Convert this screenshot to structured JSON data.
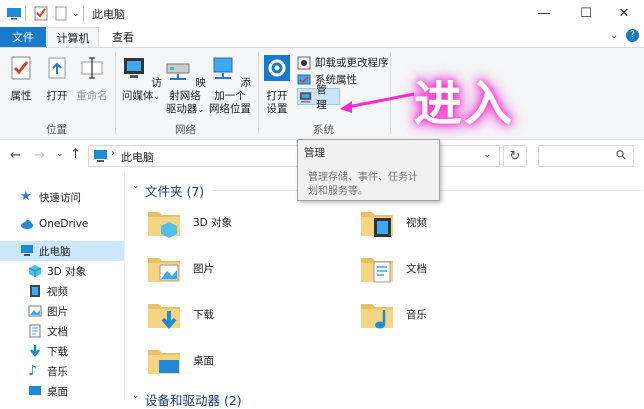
{
  "window": {
    "title": "此电脑",
    "controls": {
      "minimize": "—",
      "maximize": "☐",
      "close": "✕"
    }
  },
  "tabs": [
    {
      "label": "文件",
      "active_color": "#1979ca"
    },
    {
      "label": "计算机"
    },
    {
      "label": "查看"
    }
  ],
  "help_glyph": "?",
  "collapse_glyph": "⌄",
  "ribbon": {
    "location_group": {
      "label": "位置",
      "buttons": [
        {
          "label": "属性",
          "icon": "checklist-icon"
        },
        {
          "label": "打开",
          "icon": "open-icon"
        },
        {
          "label": "重命名",
          "icon": "rename-icon"
        }
      ]
    },
    "network_group": {
      "label": "网络",
      "buttons": [
        {
          "label_line1": "访问媒体",
          "icon": "media-icon"
        },
        {
          "label_line1": "映射网络",
          "label_line2": "驱动器",
          "icon": "map-drive-icon"
        },
        {
          "label_line1": "添加一个",
          "label_line2": "网络位置",
          "icon": "network-location-icon"
        }
      ]
    },
    "system_group": {
      "label": "系统",
      "open_settings": {
        "label_line1": "打开",
        "label_line2": "设置",
        "icon": "settings-gear-icon"
      },
      "small_buttons": [
        {
          "label": "卸载或更改程序",
          "icon": "uninstall-icon"
        },
        {
          "label": "系统属性",
          "icon": "system-properties-icon"
        },
        {
          "label": "管理",
          "icon": "manage-icon"
        }
      ]
    }
  },
  "annotation": {
    "text": "进入",
    "color": "#ff3bd4"
  },
  "address": {
    "path": "此电脑",
    "search_glyph": "⚲",
    "refresh_glyph": "↻"
  },
  "tooltip": {
    "title": "管理",
    "line1": "管理存储、事件、任务计",
    "line2": "划和服务等。"
  },
  "nav_pane": [
    {
      "label": "快速访问",
      "icon": "star-icon"
    },
    {
      "label": "OneDrive",
      "icon": "cloud-icon"
    },
    {
      "label": "此电脑",
      "icon": "computer-icon",
      "selected": true
    },
    {
      "label": "3D 对象",
      "icon": "cube-icon"
    },
    {
      "label": "视频",
      "icon": "video-icon"
    },
    {
      "label": "图片",
      "icon": "picture-icon"
    },
    {
      "label": "文档",
      "icon": "document-icon"
    },
    {
      "label": "下载",
      "icon": "download-icon"
    },
    {
      "label": "音乐",
      "icon": "music-icon"
    },
    {
      "label": "桌面",
      "icon": "desktop-icon"
    }
  ],
  "content": {
    "folders_header": "文件夹 (7)",
    "folders": [
      {
        "label": "3D 对象",
        "icon": "cube-icon"
      },
      {
        "label": "视频",
        "icon": "film-icon"
      },
      {
        "label": "图片",
        "icon": "picture-icon"
      },
      {
        "label": "文档",
        "icon": "document-icon"
      },
      {
        "label": "下载",
        "icon": "download-arrow-icon"
      },
      {
        "label": "音乐",
        "icon": "music-note-icon"
      },
      {
        "label": "桌面",
        "icon": "desktop-icon"
      }
    ],
    "devices_header": "设备和驱动器 (2)"
  }
}
